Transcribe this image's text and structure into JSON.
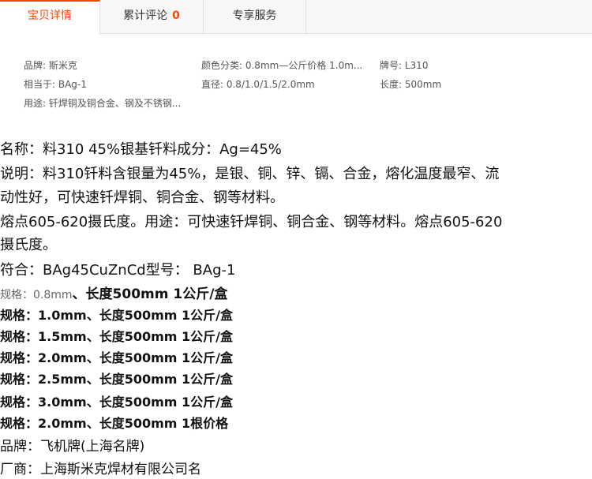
{
  "tabs": [
    {
      "label": "宝贝详情"
    },
    {
      "label": "累计评论",
      "count": "0"
    },
    {
      "label": "专享服务"
    }
  ],
  "attributes": [
    {
      "text": "品牌: 斯米克"
    },
    {
      "text": "颜色分类: 0.8mm—公斤价格 1.0m..."
    },
    {
      "text": "牌号: L310"
    },
    {
      "text": "相当于: BAg-1"
    },
    {
      "text": "直径: 0.8/1.0/1.5/2.0mm"
    },
    {
      "text": "长度: 500mm"
    },
    {
      "text": "用途: 钎焊铜及铜合金、钢及不锈钢..."
    }
  ],
  "description": {
    "l1": "名称：料310 45%银基钎料成分：Ag=45%",
    "l2": "说明：料310钎料含银量为45%，是银、铜、锌、镉、合金，熔化温度最窄、流",
    "l3": "动性好，可快速钎焊铜、铜合金、钢等材料。",
    "l4": "熔点605-620摄氏度。用途：可快速钎焊铜、铜合金、钢等材料。熔点605-620",
    "l5": "摄氏度。",
    "l6": "符合：BAg45CuZnCd型号： BAg-1",
    "l7a": "规格：0.8mm",
    "l7b": "、长度500mm 1公斤/盒",
    "l8": "规格：1.0mm、长度500mm 1公斤/盒",
    "l9": "规格：1.5mm、长度500mm 1公斤/盒",
    "l10": "规格：2.0mm、长度500mm 1公斤/盒",
    "l11": "规格：2.5mm、长度500mm 1公斤/盒",
    "l12": "规格：3.0mm、长度500mm 1公斤/盒",
    "l13": "规格：2.0mm、长度500mm 1根价格",
    "l14": "品牌：飞机牌(上海名牌)",
    "l15": "厂商：上海斯米克焊材有限公司名"
  }
}
